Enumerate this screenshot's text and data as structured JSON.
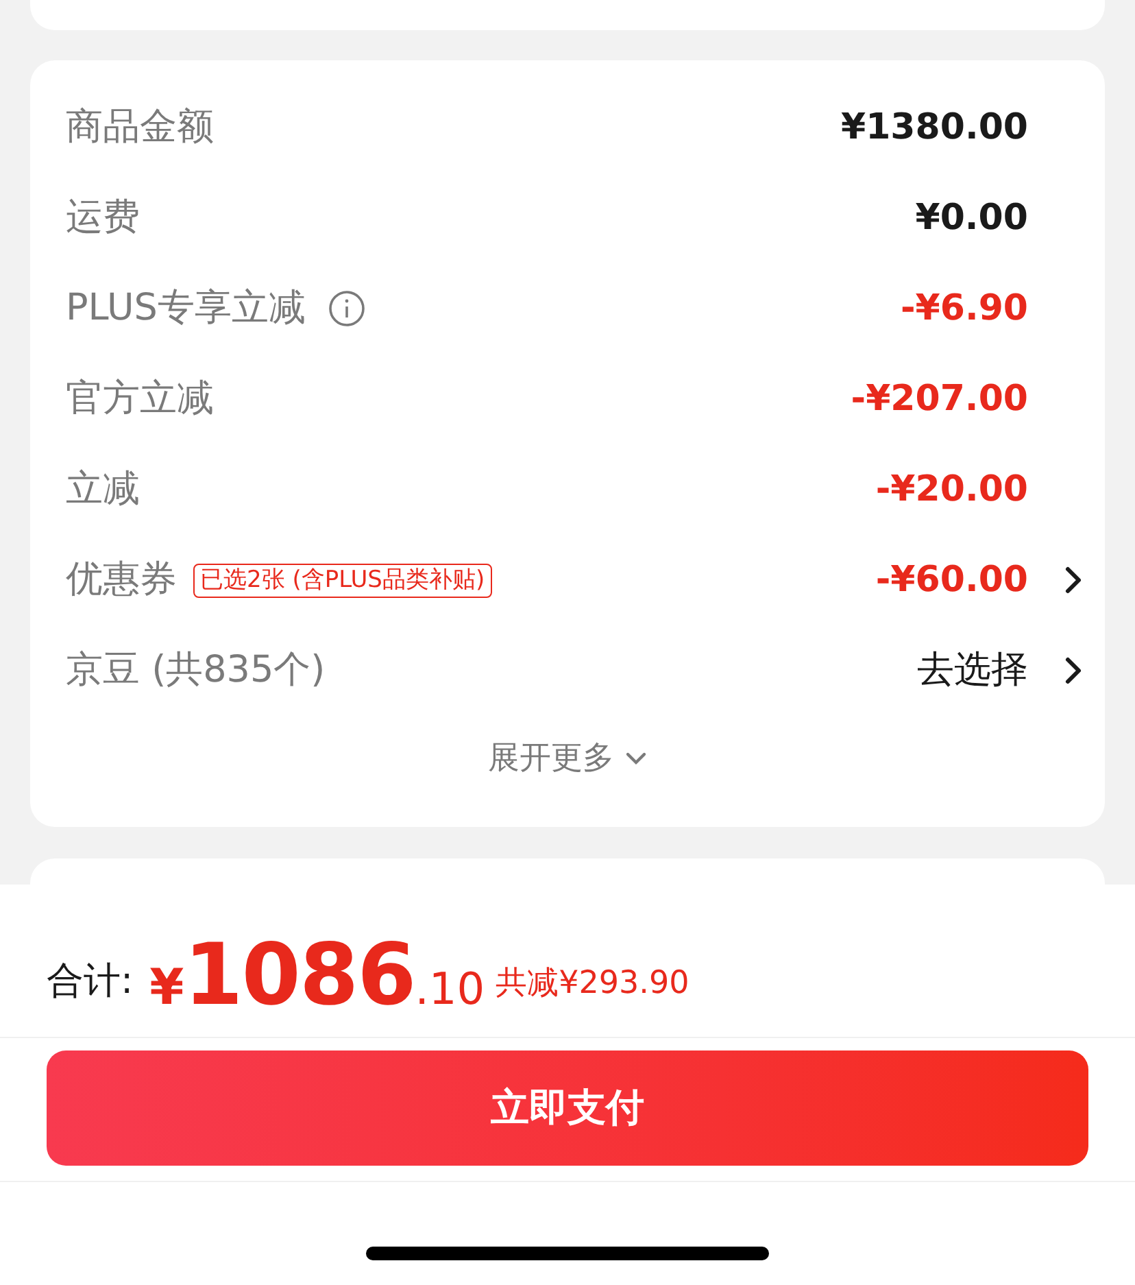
{
  "price_rows": [
    {
      "label": "商品金额",
      "kind": "amount",
      "value": "¥1380.00",
      "negative": false,
      "info": false,
      "chevron": false
    },
    {
      "label": "运费",
      "kind": "amount",
      "value": "¥0.00",
      "negative": false,
      "info": false,
      "chevron": false
    },
    {
      "label": "PLUS专享立减",
      "kind": "amount",
      "value": "-¥6.90",
      "negative": true,
      "info": true,
      "chevron": false
    },
    {
      "label": "官方立减",
      "kind": "amount",
      "value": "-¥207.00",
      "negative": true,
      "info": false,
      "chevron": false
    },
    {
      "label": "立减",
      "kind": "amount",
      "value": "-¥20.00",
      "negative": true,
      "info": false,
      "chevron": false
    },
    {
      "label": "优惠券",
      "kind": "amount",
      "badge": "已选2张 (含PLUS品类补贴)",
      "value": "-¥60.00",
      "negative": true,
      "info": false,
      "chevron": true
    },
    {
      "label": "京豆 (共835个)",
      "kind": "action",
      "value": "去选择",
      "info": false,
      "chevron": true
    }
  ],
  "expand": {
    "label": "展开更多"
  },
  "total": {
    "label": "合计:",
    "currency": "¥",
    "integer": "1086",
    "decimal": ".10",
    "saving": "共减¥293.90"
  },
  "pay_button": {
    "label": "立即支付"
  }
}
